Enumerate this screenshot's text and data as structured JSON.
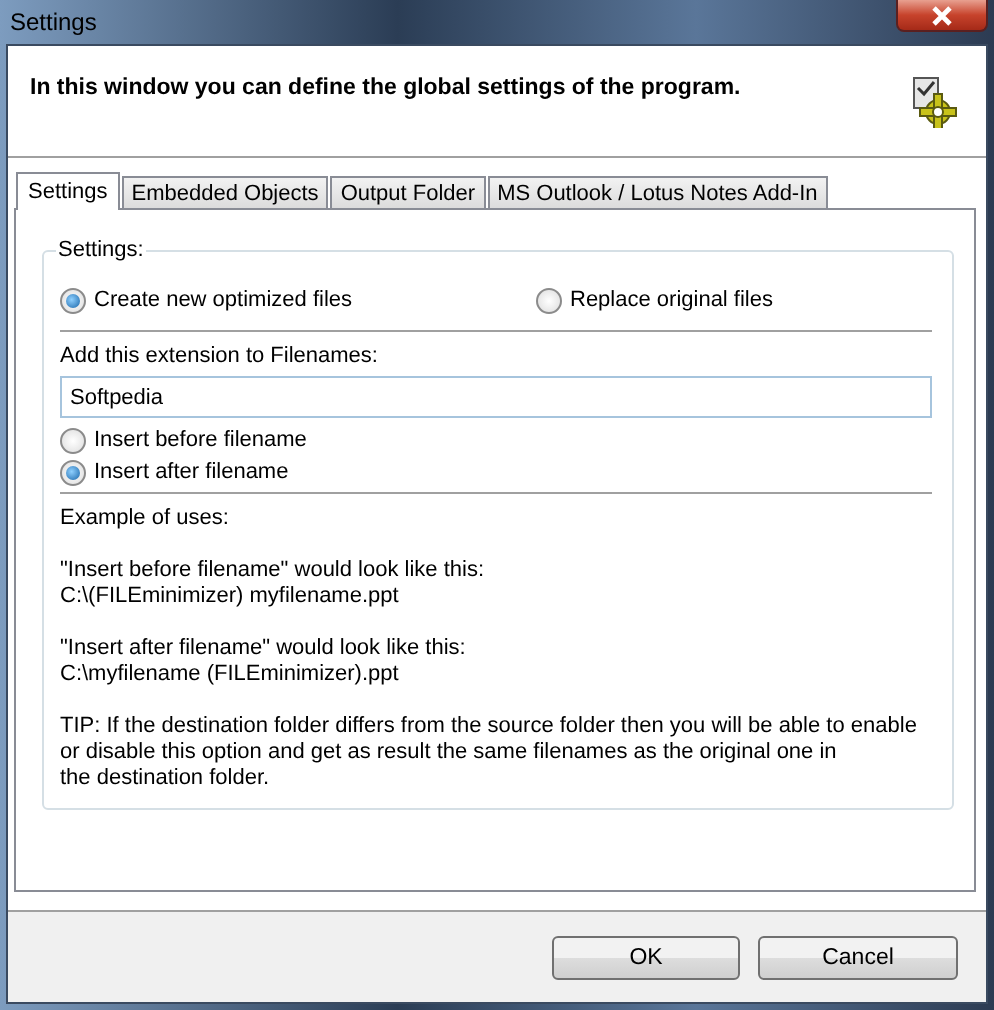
{
  "window": {
    "title": "Settings"
  },
  "header": {
    "text": "In this window you can define the global settings of the program."
  },
  "tabs": [
    {
      "label": "Settings",
      "selected": true
    },
    {
      "label": "Embedded Objects",
      "selected": false
    },
    {
      "label": "Output Folder",
      "selected": false
    },
    {
      "label": "MS Outlook / Lotus Notes Add-In",
      "selected": false
    }
  ],
  "settings_group": {
    "title": "Settings:",
    "mode_options": [
      {
        "label": "Create new optimized files",
        "selected": true
      },
      {
        "label": "Replace original files",
        "selected": false
      }
    ],
    "extension_label": "Add this extension to Filenames:",
    "extension_field": {
      "value": "Softpedia"
    },
    "position_options": [
      {
        "label": "Insert before filename",
        "selected": false
      },
      {
        "label": "Insert after filename",
        "selected": true
      }
    ],
    "examples": [
      "Example of uses:",
      "\"Insert before filename\" would look like this:\nC:\\(FILEminimizer) myfilename.ppt",
      "\"Insert after filename\" would look like this:\nC:\\myfilename (FILEminimizer).ppt",
      "TIP: If the destination folder differs from the source folder then you will be able to enable\nor disable this option and get as result the same filenames as the original one in\nthe destination folder."
    ]
  },
  "buttons": [
    "OK",
    "Cancel"
  ]
}
